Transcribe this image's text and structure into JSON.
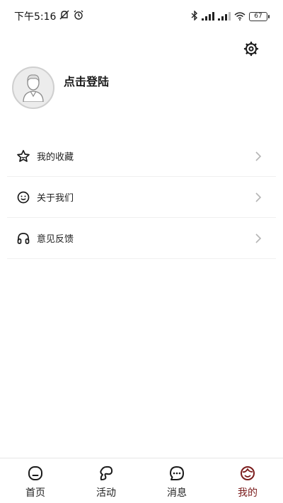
{
  "status_bar": {
    "time": "下午5:16",
    "battery": "67"
  },
  "profile": {
    "login_prompt": "点击登陆"
  },
  "menu": {
    "items": [
      {
        "label": "我的收藏",
        "icon": "star-icon"
      },
      {
        "label": "关于我们",
        "icon": "smiley-icon"
      },
      {
        "label": "意见反馈",
        "icon": "headphones-icon"
      }
    ]
  },
  "tabbar": {
    "tabs": [
      {
        "label": "首页",
        "icon": "home-icon",
        "active": false
      },
      {
        "label": "活动",
        "icon": "activity-icon",
        "active": false
      },
      {
        "label": "消息",
        "icon": "message-icon",
        "active": false
      },
      {
        "label": "我的",
        "icon": "profile-icon",
        "active": true
      }
    ]
  },
  "colors": {
    "active_tab": "#7a1b1b",
    "text": "#222222",
    "divider": "#f0f0f0"
  }
}
